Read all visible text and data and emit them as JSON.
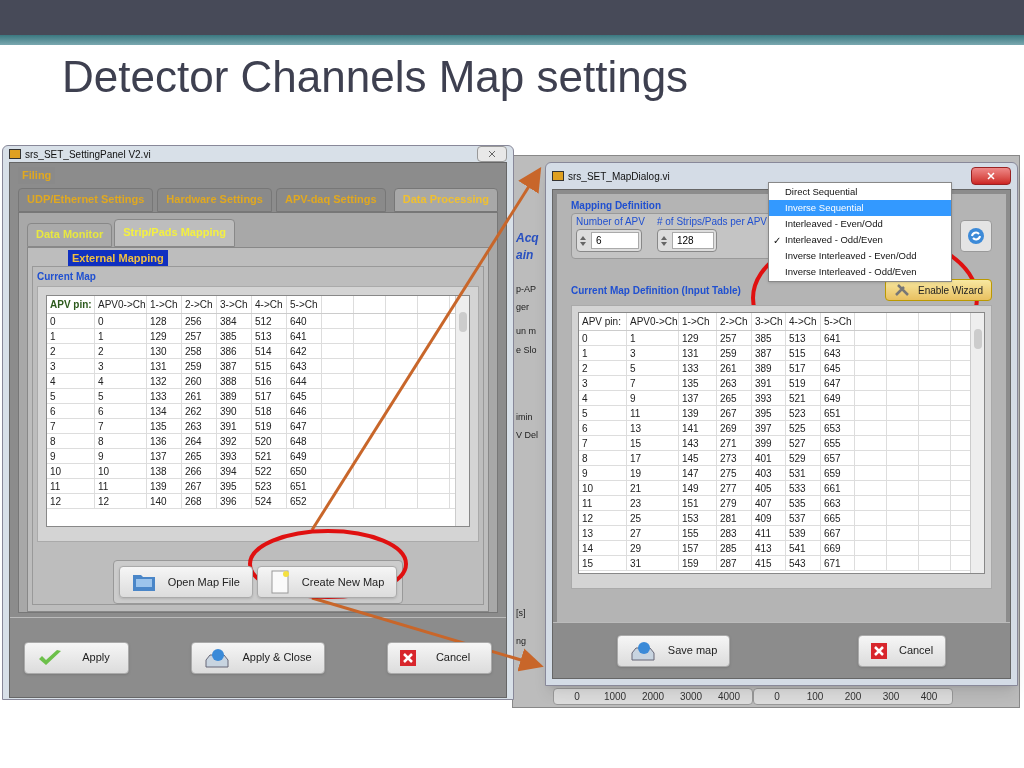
{
  "slide": {
    "title": "Detector Channels Map settings"
  },
  "settings_window": {
    "title": "srs_SET_SettingPanel V2.vi",
    "tabs_row_1": [
      {
        "label": "Filing",
        "selected": false
      }
    ],
    "tabs_row_2": [
      {
        "label": "UDP/Ethernet Settings",
        "selected": false
      },
      {
        "label": "Hardware Settings",
        "selected": false
      },
      {
        "label": "APV-daq Settings",
        "selected": false
      },
      {
        "label": "Data Processing",
        "selected": true
      }
    ],
    "sub_tabs": [
      {
        "label": "Data Monitor",
        "selected": false
      },
      {
        "label": "Strip/Pads Mapping",
        "selected": true
      }
    ],
    "group_label": "External Mapping",
    "table_label": "Current Map",
    "table": {
      "columns": [
        "APV pin:",
        "APV0->Ch",
        "1->Ch",
        "2->Ch",
        "3->Ch",
        "4->Ch",
        "5->Ch"
      ],
      "rows": [
        [
          "0",
          "0",
          "128",
          "256",
          "384",
          "512",
          "640"
        ],
        [
          "1",
          "1",
          "129",
          "257",
          "385",
          "513",
          "641"
        ],
        [
          "2",
          "2",
          "130",
          "258",
          "386",
          "514",
          "642"
        ],
        [
          "3",
          "3",
          "131",
          "259",
          "387",
          "515",
          "643"
        ],
        [
          "4",
          "4",
          "132",
          "260",
          "388",
          "516",
          "644"
        ],
        [
          "5",
          "5",
          "133",
          "261",
          "389",
          "517",
          "645"
        ],
        [
          "6",
          "6",
          "134",
          "262",
          "390",
          "518",
          "646"
        ],
        [
          "7",
          "7",
          "135",
          "263",
          "391",
          "519",
          "647"
        ],
        [
          "8",
          "8",
          "136",
          "264",
          "392",
          "520",
          "648"
        ],
        [
          "9",
          "9",
          "137",
          "265",
          "393",
          "521",
          "649"
        ],
        [
          "10",
          "10",
          "138",
          "266",
          "394",
          "522",
          "650"
        ],
        [
          "11",
          "11",
          "139",
          "267",
          "395",
          "523",
          "651"
        ],
        [
          "12",
          "12",
          "140",
          "268",
          "396",
          "524",
          "652"
        ]
      ]
    },
    "map_buttons": [
      {
        "label": "Open Map File",
        "kind": "folder"
      },
      {
        "label": "Create New Map",
        "kind": "page"
      }
    ],
    "buttons": [
      {
        "label": "Apply",
        "kind": "check"
      },
      {
        "label": "Apply & Close",
        "kind": "tray"
      },
      {
        "label": "Cancel",
        "kind": "cross"
      }
    ]
  },
  "background_window": {
    "fragments": [
      "Acq",
      "ain",
      "p-AP",
      "ger",
      "un m",
      "e Slo",
      "imin",
      "V Del",
      "[s]",
      "ng"
    ],
    "scale_1": [
      "0",
      "1000",
      "2000",
      "3000",
      "4000"
    ],
    "scale_2": [
      "0",
      "100",
      "200",
      "300",
      "400"
    ]
  },
  "map_dialog": {
    "title": "srs_SET_MapDialog.vi",
    "section_label": "Mapping Definition",
    "fields": [
      {
        "label": "Number of APV",
        "value": "6"
      },
      {
        "label": "# of Strips/Pads per APV",
        "value": "128"
      }
    ],
    "menu": [
      {
        "label": "Direct Sequential",
        "selected": false,
        "checked": false
      },
      {
        "label": "Inverse Sequential",
        "selected": true,
        "checked": false
      },
      {
        "label": "Interleaved - Even/Odd",
        "selected": false,
        "checked": false
      },
      {
        "label": "Interleaved - Odd/Even",
        "selected": false,
        "checked": true
      },
      {
        "label": "Inverse Interleaved - Even/Odd",
        "selected": false,
        "checked": false
      },
      {
        "label": "Inverse Interleaved - Odd/Even",
        "selected": false,
        "checked": false
      }
    ],
    "check_mark": "✓",
    "wizard_button": "Enable Wizard",
    "table_label": "Current Map Definition (Input Table)",
    "table": {
      "columns": [
        "APV pin:",
        "APV0->Ch",
        "1->Ch",
        "2->Ch",
        "3->Ch",
        "4->Ch",
        "5->Ch"
      ],
      "rows": [
        [
          "0",
          "1",
          "129",
          "257",
          "385",
          "513",
          "641"
        ],
        [
          "1",
          "3",
          "131",
          "259",
          "387",
          "515",
          "643"
        ],
        [
          "2",
          "5",
          "133",
          "261",
          "389",
          "517",
          "645"
        ],
        [
          "3",
          "7",
          "135",
          "263",
          "391",
          "519",
          "647"
        ],
        [
          "4",
          "9",
          "137",
          "265",
          "393",
          "521",
          "649"
        ],
        [
          "5",
          "11",
          "139",
          "267",
          "395",
          "523",
          "651"
        ],
        [
          "6",
          "13",
          "141",
          "269",
          "397",
          "525",
          "653"
        ],
        [
          "7",
          "15",
          "143",
          "271",
          "399",
          "527",
          "655"
        ],
        [
          "8",
          "17",
          "145",
          "273",
          "401",
          "529",
          "657"
        ],
        [
          "9",
          "19",
          "147",
          "275",
          "403",
          "531",
          "659"
        ],
        [
          "10",
          "21",
          "149",
          "277",
          "405",
          "533",
          "661"
        ],
        [
          "11",
          "23",
          "151",
          "279",
          "407",
          "535",
          "663"
        ],
        [
          "12",
          "25",
          "153",
          "281",
          "409",
          "537",
          "665"
        ],
        [
          "13",
          "27",
          "155",
          "283",
          "411",
          "539",
          "667"
        ],
        [
          "14",
          "29",
          "157",
          "285",
          "413",
          "541",
          "669"
        ],
        [
          "15",
          "31",
          "159",
          "287",
          "415",
          "543",
          "671"
        ]
      ]
    },
    "buttons": [
      {
        "label": "Save map",
        "kind": "tray"
      },
      {
        "label": "Cancel",
        "kind": "cross"
      }
    ]
  }
}
